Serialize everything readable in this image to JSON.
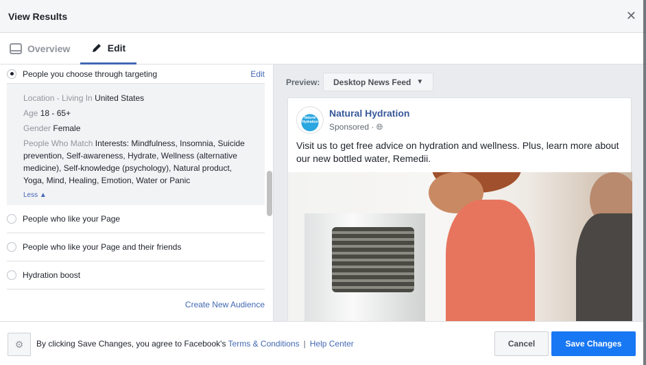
{
  "header": {
    "title": "View Results",
    "close_icon": "close-icon"
  },
  "tabs": [
    {
      "label": "Overview",
      "icon": "tablet-icon",
      "active": false
    },
    {
      "label": "Edit",
      "icon": "pencil-icon",
      "active": true
    }
  ],
  "audience": {
    "options": [
      {
        "label": "People you choose through targeting",
        "selected": true,
        "action": "Edit"
      },
      {
        "label": "People who like your Page",
        "selected": false
      },
      {
        "label": "People who like your Page and their friends",
        "selected": false
      },
      {
        "label": "Hydration boost",
        "selected": false
      }
    ],
    "details": {
      "location_key": "Location - Living In",
      "location_val": "United States",
      "age_key": "Age",
      "age_val": "18 - 65+",
      "gender_key": "Gender",
      "gender_val": "Female",
      "match_key": "People Who Match",
      "match_val": "Interests: Mindfulness, Insomnia, Suicide prevention, Self-awareness, Hydrate, Wellness (alternative medicine), Self-knowledge (psychology), Natural product, Yoga, Mind, Healing, Emotion, Water or Panic",
      "less": "Less"
    },
    "create_link": "Create New Audience"
  },
  "preview": {
    "label": "Preview:",
    "placement": "Desktop News Feed",
    "page_name": "Natural Hydration",
    "logo_text": "Natural Hydration",
    "sponsored": "Sponsored ·",
    "message": "Visit us to get free advice on hydration and wellness. Plus, learn more about our new bottled water, Remedii."
  },
  "footer": {
    "prefix": "By clicking Save Changes, you agree to Facebook's",
    "terms": "Terms & Conditions",
    "sep": "|",
    "help": "Help Center",
    "cancel": "Cancel",
    "save": "Save Changes"
  },
  "colors": {
    "primary": "#1877f2",
    "link": "#4267b2",
    "page_name": "#385898"
  }
}
